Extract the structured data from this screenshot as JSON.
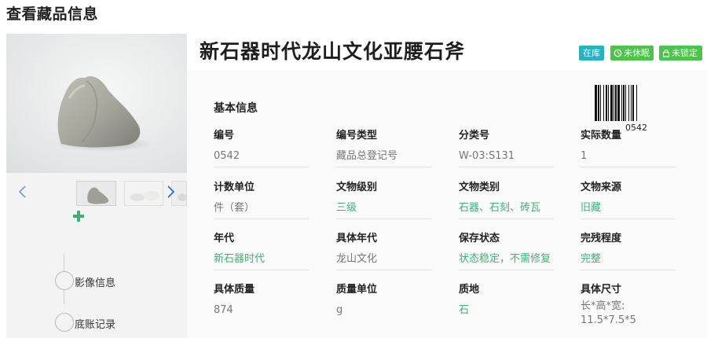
{
  "page": {
    "title": "查看藏品信息"
  },
  "gallery": {
    "prev_icon": "chevron-left-icon",
    "next_icon": "chevron-right-icon",
    "thumbnail_count": 3
  },
  "timeline": {
    "add_icon": "plus-icon",
    "items": [
      {
        "label": "影像信息"
      },
      {
        "label": "底账记录"
      }
    ]
  },
  "detail": {
    "title": "新石器时代龙山文化亚腰石斧",
    "badges": [
      {
        "label": "在库",
        "color": "#25b3c3"
      },
      {
        "label": "未休眠",
        "icon": "clock-icon",
        "color": "#4cc44c"
      },
      {
        "label": "未锁定",
        "icon": "lock-icon",
        "color": "#4cc44c"
      }
    ],
    "section_title": "基本信息",
    "barcode_number": "0542",
    "fields": [
      {
        "label": "编号",
        "value": "0542",
        "link": false
      },
      {
        "label": "编号类型",
        "value": "藏品总登记号",
        "link": false
      },
      {
        "label": "分类号",
        "value": "W-03:S131",
        "link": false
      },
      {
        "label": "实际数量",
        "value": "1",
        "link": false
      },
      {
        "label": "计数单位",
        "value": "件（套）",
        "link": false
      },
      {
        "label": "文物级别",
        "value": "三级",
        "link": true
      },
      {
        "label": "文物类别",
        "value": "石器、石刻、砖瓦",
        "link": true
      },
      {
        "label": "文物来源",
        "value": "旧藏",
        "link": true
      },
      {
        "label": "年代",
        "value": "新石器时代",
        "link": true
      },
      {
        "label": "具体年代",
        "value": "龙山文化",
        "link": false
      },
      {
        "label": "保存状态",
        "value": "状态稳定，不需修复",
        "link": true
      },
      {
        "label": "完残程度",
        "value": "完整",
        "link": true
      },
      {
        "label": "具体质量",
        "value": "874",
        "link": false
      },
      {
        "label": "质量单位",
        "value": "g",
        "link": false
      },
      {
        "label": "质地",
        "value": "石",
        "link": true
      },
      {
        "label": "具体尺寸",
        "value": "长*高*宽: 11.5*7.5*5",
        "link": false
      }
    ]
  },
  "colors": {
    "accent_green": "#3fb075",
    "teal": "#25b3c3",
    "badge_green": "#4cc44c"
  }
}
